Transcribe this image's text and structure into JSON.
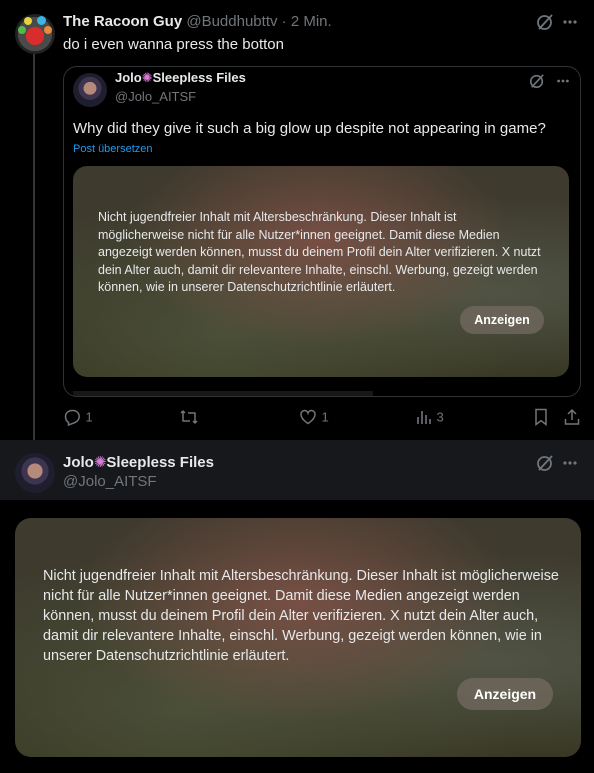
{
  "top_post": {
    "author_name": "The Racoon Guy",
    "handle": "@Buddhubttv",
    "time": "· 2 Min.",
    "text": "do i even wanna press the botton"
  },
  "quote": {
    "author_prefix": "Jolo",
    "author_suffix": "Sleepless Files",
    "handle": "@Jolo_AITSF",
    "text": "Why did they give it such a big glow up despite not appearing in game?",
    "translate": "Post übersetzen",
    "warning": "Nicht jugendfreier Inhalt mit Altersbeschränkung. Dieser Inhalt ist möglicherweise nicht für alle Nutzer*innen geeignet. Damit diese Medien angezeigt werden können, musst du deinem Profil dein Alter verifizieren. X nutzt dein Alter auch, damit dir relevantere Inhalte, einschl. Werbung, gezeigt werden können, wie in unserer Datenschutzrichtlinie erläutert.",
    "show_button": "Anzeigen"
  },
  "actions": {
    "reply_count": "1",
    "like_count": "1",
    "view_count": "3"
  },
  "second_post": {
    "author_prefix": "Jolo",
    "author_suffix": "Sleepless Files",
    "handle": "@Jolo_AITSF",
    "warning": "Nicht jugendfreier Inhalt mit Altersbeschränkung. Dieser Inhalt ist möglicherweise nicht für alle Nutzer*innen geeignet. Damit diese Medien angezeigt werden können, musst du deinem Profil dein Alter verifizieren. X nutzt dein Alter auch, damit dir relevantere Inhalte, einschl. Werbung, gezeigt werden können, wie in unserer Datenschutzrichtlinie erläutert.",
    "show_button": "Anzeigen"
  },
  "icons": {
    "grok": "grok-icon",
    "more": "more-icon",
    "reply": "reply-icon",
    "repost": "repost-icon",
    "like": "like-icon",
    "views": "views-icon",
    "bookmark": "bookmark-icon",
    "share": "share-icon"
  }
}
